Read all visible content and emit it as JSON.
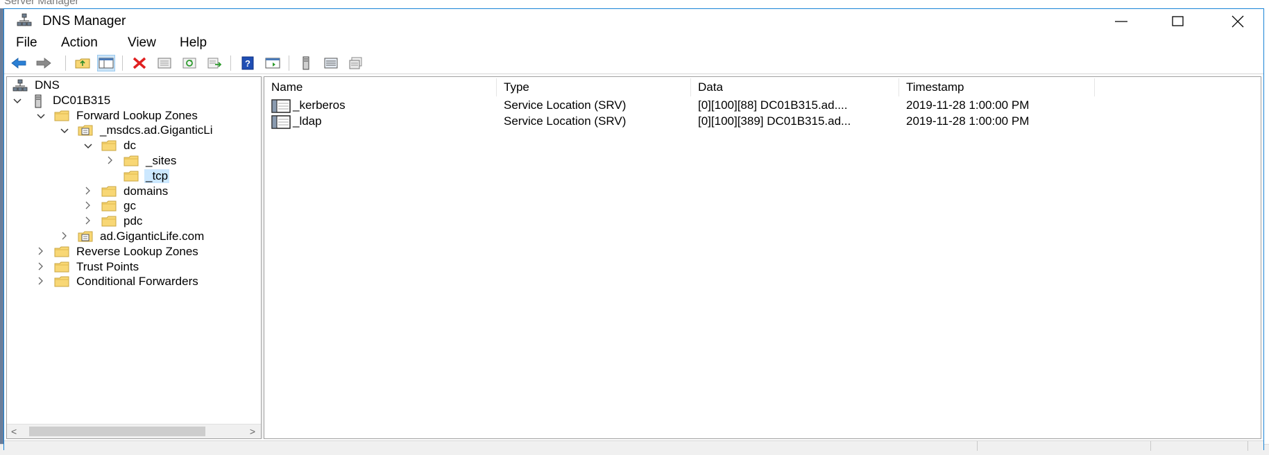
{
  "background": {
    "window_title": "Server Manager"
  },
  "window": {
    "title": "DNS Manager"
  },
  "menu": [
    "File",
    "Action",
    "View",
    "Help"
  ],
  "toolbar": {
    "buttons": [
      "back",
      "forward",
      "up-one-level",
      "show-hide-console-tree",
      "delete",
      "properties",
      "refresh",
      "export-list",
      "help",
      "show-hide-action-pane",
      "server",
      "list",
      "detail"
    ]
  },
  "tree": [
    {
      "label": "DNS",
      "icon": "dns-icon",
      "expander": ""
    },
    {
      "label": "DC01B315",
      "icon": "server-icon",
      "expander": "v"
    },
    {
      "label": "Forward Lookup Zones",
      "icon": "folder-icon",
      "expander": "v"
    },
    {
      "label": "_msdcs.ad.GiganticLi",
      "icon": "zone-icon",
      "expander": "v"
    },
    {
      "label": "dc",
      "icon": "folder-icon",
      "expander": "v"
    },
    {
      "label": "_sites",
      "icon": "folder-icon",
      "expander": ">"
    },
    {
      "label": "_tcp",
      "icon": "folder-icon",
      "expander": "",
      "selected": true
    },
    {
      "label": "domains",
      "icon": "folder-icon",
      "expander": ">"
    },
    {
      "label": "gc",
      "icon": "folder-icon",
      "expander": ">"
    },
    {
      "label": "pdc",
      "icon": "folder-icon",
      "expander": ">"
    },
    {
      "label": "ad.GiganticLife.com",
      "icon": "zone-icon",
      "expander": ">"
    },
    {
      "label": "Reverse Lookup Zones",
      "icon": "folder-icon",
      "expander": ">"
    },
    {
      "label": "Trust Points",
      "icon": "folder-icon",
      "expander": ">"
    },
    {
      "label": "Conditional Forwarders",
      "icon": "folder-icon",
      "expander": ">"
    }
  ],
  "list": {
    "columns": [
      "Name",
      "Type",
      "Data",
      "Timestamp"
    ],
    "rows": [
      {
        "name": "_kerberos",
        "type": "Service Location (SRV)",
        "data": "[0][100][88] DC01B315.ad....",
        "timestamp": "2019-11-28 1:00:00 PM"
      },
      {
        "name": "_ldap",
        "type": "Service Location (SRV)",
        "data": "[0][100][389] DC01B315.ad...",
        "timestamp": "2019-11-28 1:00:00 PM"
      }
    ]
  },
  "colors": {
    "accent": "#1883d7",
    "selection": "#cce8ff",
    "folder": "#f8d775"
  }
}
